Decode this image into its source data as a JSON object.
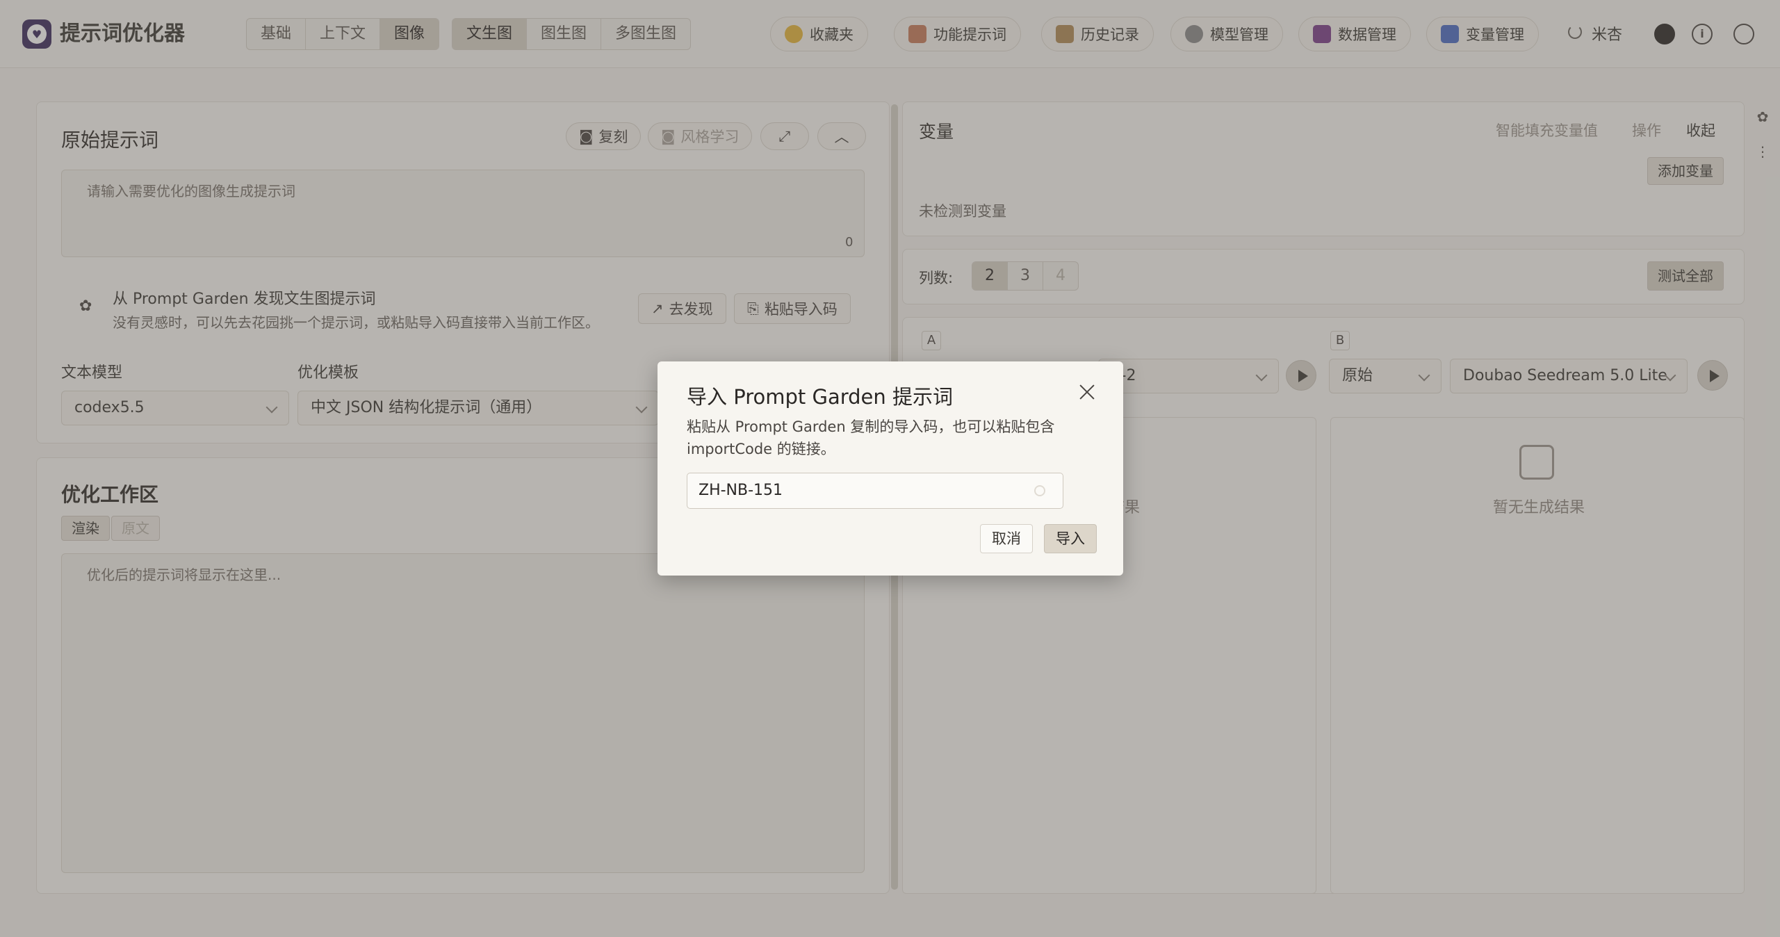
{
  "app": {
    "title": "提示词优化器"
  },
  "mode_tabs": [
    "基础",
    "上下文",
    "图像"
  ],
  "gen_tabs": [
    "文生图",
    "图生图",
    "多图生图"
  ],
  "header_pills": [
    {
      "label": "收藏夹",
      "icon": "star-icon",
      "color": "#e6b63a"
    },
    {
      "label": "功能提示词",
      "icon": "prompt-icon",
      "color": "#c77b5a"
    },
    {
      "label": "历史记录",
      "icon": "history-icon",
      "color": "#b08b55"
    },
    {
      "label": "模型管理",
      "icon": "gear-icon",
      "color": "#8a8a8a"
    },
    {
      "label": "数据管理",
      "icon": "save-icon",
      "color": "#7a3d8a"
    },
    {
      "label": "变量管理",
      "icon": "variable-icon",
      "color": "#4a6cc4"
    }
  ],
  "user": {
    "name": "米杏"
  },
  "original": {
    "title": "原始提示词",
    "copy_label": "复刻",
    "style_label": "风格学习",
    "placeholder": "请输入需要优化的图像生成提示词",
    "count": "0"
  },
  "garden": {
    "title": "从 Prompt Garden 发现文生图提示词",
    "desc": "没有灵感时，可以先去花园挑一个提示词，或粘贴导入码直接带入当前工作区。",
    "discover_label": "去发现",
    "paste_label": "粘贴导入码"
  },
  "model": {
    "label": "文本模型",
    "value": "codex5.5"
  },
  "template": {
    "label": "优化模板",
    "value": "中文 JSON 结构化提示词（通用）"
  },
  "workspace": {
    "title": "优化工作区",
    "tab_render": "渲染",
    "tab_source": "原文",
    "placeholder": "优化后的提示词将显示在这里..."
  },
  "variables": {
    "title": "变量",
    "smart_fill": "智能填充变量值",
    "operate": "操作",
    "collapse": "收起",
    "add_label": "添加变量",
    "empty": "未检测到变量"
  },
  "columns": {
    "label": "列数:",
    "options": [
      "2",
      "3",
      "4"
    ],
    "test_all": "测试全部"
  },
  "columnA": {
    "tag": "A",
    "model_tail": "e-2",
    "empty": "结果"
  },
  "columnB": {
    "tag": "B",
    "source": "原始",
    "model": "Doubao Seedream 5.0 Lite",
    "empty": "暂无生成结果"
  },
  "modal": {
    "title": "导入 Prompt Garden 提示词",
    "desc": "粘贴从 Prompt Garden 复制的导入码，也可以粘贴包含 importCode 的链接。",
    "input_value": "ZH-NB-151",
    "cancel": "取消",
    "import": "导入"
  }
}
